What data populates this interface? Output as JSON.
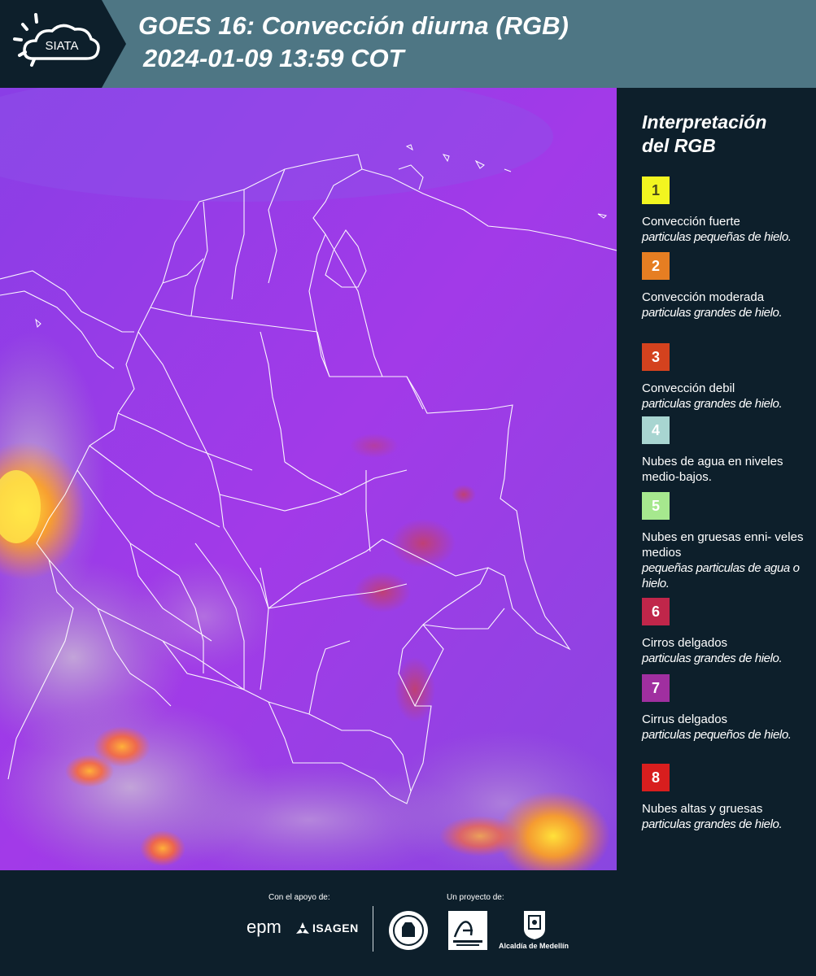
{
  "header": {
    "logo_text": "SIATA",
    "title_line1": "GOES 16: Convección diurna (RGB)",
    "title_line2": "2024-01-09 13:59 COT"
  },
  "legend": {
    "title_line1": "Interpretación",
    "title_line2": "del RGB",
    "items": [
      {
        "number": "1",
        "color": "#f2f520",
        "num_color": "#4a4a1a",
        "label": "Convección fuerte",
        "sub": "particulas pequeñas de hielo."
      },
      {
        "number": "2",
        "color": "#e67e22",
        "num_color": "#ffffff",
        "label": "Convección moderada",
        "sub": "particulas grandes de hielo."
      },
      {
        "number": "3",
        "color": "#d4421e",
        "num_color": "#ffffff",
        "label": "Convección debil",
        "sub": "particulas grandes de hielo."
      },
      {
        "number": "4",
        "color": "#a8d5d1",
        "num_color": "#ffffff",
        "label": "Nubes de agua en niveles medio-bajos.",
        "sub": ""
      },
      {
        "number": "5",
        "color": "#a6e88e",
        "num_color": "#ffffff",
        "label": "Nubes en gruesas enni- veles medios",
        "sub": "pequeñas particulas de agua o hielo."
      },
      {
        "number": "6",
        "color": "#c0264a",
        "num_color": "#ffffff",
        "label": "Cirros delgados",
        "sub": "particulas grandes de hielo."
      },
      {
        "number": "7",
        "color": "#a02fa0",
        "num_color": "#ffffff",
        "label": "Cirrus delgados",
        "sub": "particulas pequeños de hielo."
      },
      {
        "number": "8",
        "color": "#d81e1e",
        "num_color": "#ffffff",
        "label": "Nubes altas y gruesas",
        "sub": "particulas grandes de hielo."
      }
    ]
  },
  "footer": {
    "support_label": "Con el apoyo de:",
    "project_label": "Un proyecto de:",
    "sponsor1": "epm",
    "sponsor2": "ISAGEN",
    "partner3": "Alcaldía de Medellín"
  },
  "map": {
    "base_color": "#9a3ae8",
    "region": "Colombia"
  }
}
